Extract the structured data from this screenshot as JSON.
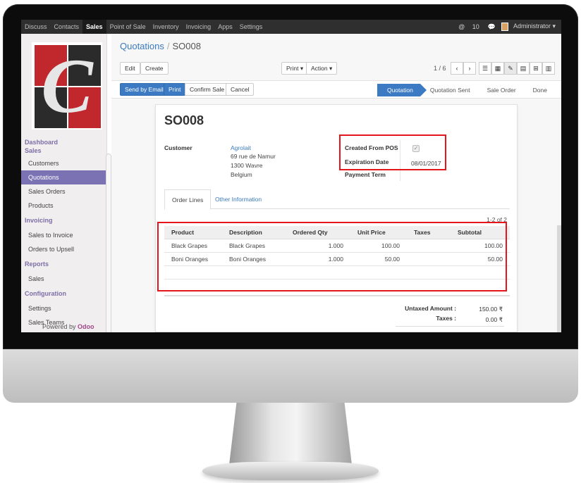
{
  "topnav": {
    "items": [
      "Discuss",
      "Contacts",
      "Sales",
      "Point of Sale",
      "Inventory",
      "Invoicing",
      "Apps",
      "Settings"
    ],
    "active": "Sales",
    "notif_count": "10",
    "user": "Administrator ▾"
  },
  "sidebar": {
    "sections": [
      {
        "title": "Dashboard",
        "items": []
      },
      {
        "title": "Sales",
        "items": [
          "Customers",
          "Quotations",
          "Sales Orders",
          "Products"
        ]
      },
      {
        "title": "Invoicing",
        "items": [
          "Sales to Invoice",
          "Orders to Upsell"
        ]
      },
      {
        "title": "Reports",
        "items": [
          "Sales"
        ]
      },
      {
        "title": "Configuration",
        "items": [
          "Settings",
          "Sales Teams"
        ]
      }
    ],
    "selected": "Quotations",
    "powered_by": "Powered by",
    "powered_brand": "Odoo"
  },
  "breadcrumb": {
    "parent": "Quotations",
    "sep": "/",
    "current": "SO008"
  },
  "toolbar": {
    "edit": "Edit",
    "create": "Create",
    "print": "Print ▾",
    "action": "Action ▾",
    "pager": "1 / 6",
    "prev": "‹",
    "next": "›"
  },
  "statusbar": {
    "send_email": "Send by Email",
    "print": "Print",
    "confirm": "Confirm Sale",
    "cancel": "Cancel",
    "stages": [
      "Quotation",
      "Quotation Sent",
      "Sale Order",
      "Done"
    ],
    "current_stage": "Quotation"
  },
  "form": {
    "name": "SO008",
    "customer_label": "Customer",
    "customer_name": "Agrolait",
    "address": [
      "69 rue de Namur",
      "1300 Wavre",
      "Belgium"
    ],
    "created_from_pos_label": "Created From POS",
    "created_from_pos": true,
    "expiration_label": "Expiration Date",
    "expiration_date": "08/01/2017",
    "payment_term_label": "Payment Term"
  },
  "tabs": [
    "Order Lines",
    "Other Information"
  ],
  "lines": {
    "count": "1-2 of 2",
    "columns": [
      "Product",
      "Description",
      "Ordered Qty",
      "Unit Price",
      "Taxes",
      "Subtotal"
    ],
    "rows": [
      {
        "product": "Black Grapes",
        "description": "Black Grapes",
        "qty": "1.000",
        "price": "100.00",
        "taxes": "",
        "subtotal": "100.00"
      },
      {
        "product": "Boni Oranges",
        "description": "Boni Oranges",
        "qty": "1.000",
        "price": "50.00",
        "taxes": "",
        "subtotal": "50.00"
      }
    ]
  },
  "totals": {
    "untaxed_label": "Untaxed Amount :",
    "untaxed": "150.00 ₹",
    "taxes_label": "Taxes :",
    "taxes": "0.00 ₹"
  },
  "colors": {
    "accent": "#3c7bc4",
    "sidebar_selected": "#7b72b4",
    "highlight": "#e5161b",
    "brand": "#a24689"
  }
}
